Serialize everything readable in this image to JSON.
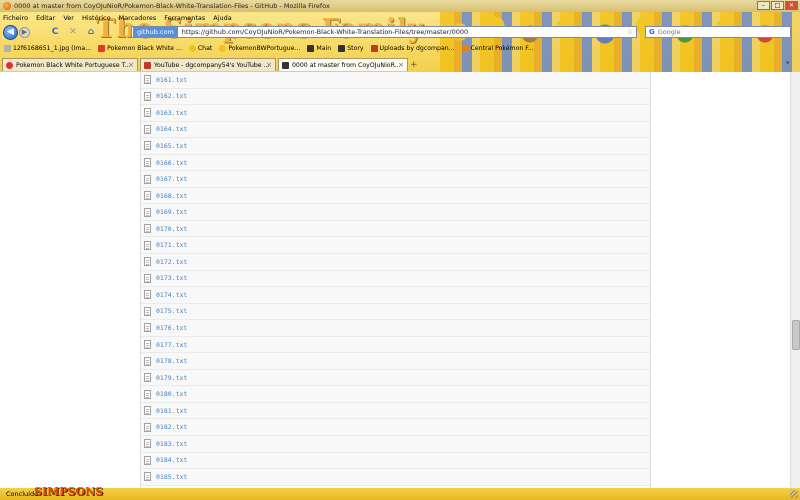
{
  "window": {
    "title": "0000 at master from CoyOJuNioR/Pokemon-Black-White-Translation-Files - GitHub - Mozilla Firefox",
    "minimize": "–",
    "maximize": "□",
    "close": "✕"
  },
  "theme": {
    "logo": "The Simpsons Family",
    "statusbrand": "SIMPSONS"
  },
  "menu": [
    "Ficheiro",
    "Editar",
    "Ver",
    "Histórico",
    "Marcadores",
    "Ferramentas",
    "Ajuda"
  ],
  "nav": {
    "back": "◀",
    "forward": "▶",
    "reload": "C",
    "stop": "✕",
    "home": "⌂",
    "site_identity": "github.com",
    "url": "https://github.com/CoyOJuNioR/Pokemon-Black-White-Translation-Files/tree/master/0000",
    "search_placeholder": "Google"
  },
  "bookmarks": [
    "12f6168651_1.jpg (Ima...",
    "Pokemon Black White ...",
    "Chat",
    "PokemonBWPortugue...",
    "Main",
    "Story",
    "Uploads by dgcompan...",
    "Central Pokémon F..."
  ],
  "tabs": [
    {
      "label": "Pokemon Black White Portuguese T...",
      "active": false
    },
    {
      "label": "YouTube - dgcompany54's YouTube ...",
      "active": false
    },
    {
      "label": "0000 at master from CoyOJuNioR...",
      "active": true
    }
  ],
  "files": [
    "0161.txt",
    "0162.txt",
    "0163.txt",
    "0164.txt",
    "0165.txt",
    "0166.txt",
    "0167.txt",
    "0168.txt",
    "0169.txt",
    "0170.txt",
    "0171.txt",
    "0172.txt",
    "0173.txt",
    "0174.txt",
    "0175.txt",
    "0176.txt",
    "0177.txt",
    "0178.txt",
    "0179.txt",
    "0180.txt",
    "0181.txt",
    "0182.txt",
    "0183.txt",
    "0184.txt",
    "0185.txt"
  ],
  "status": {
    "text": "Concluído"
  }
}
